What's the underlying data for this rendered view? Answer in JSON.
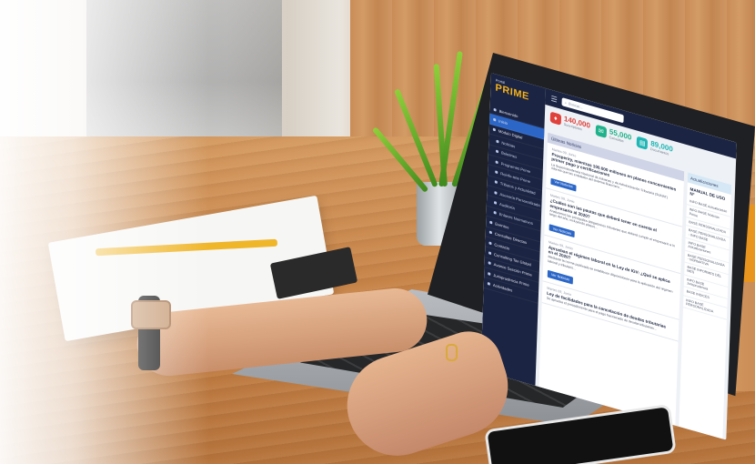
{
  "app": {
    "brand": "PRIME",
    "brand_small": "Portal",
    "search_placeholder": "Buscar..."
  },
  "sidebar": {
    "items": [
      {
        "label": "Bienvenido",
        "active": false,
        "sub": false
      },
      {
        "label": "Inicio",
        "active": true,
        "sub": false
      },
      {
        "label": "Módulo Digital",
        "active": false,
        "sub": false
      },
      {
        "label": "Noticias",
        "active": false,
        "sub": true
      },
      {
        "label": "Boletines",
        "active": false,
        "sub": true
      },
      {
        "label": "Programas Prime",
        "active": false,
        "sub": true
      },
      {
        "label": "Reinfo-arte Prime",
        "active": false,
        "sub": true
      },
      {
        "label": "Tributos y Actualidad",
        "active": false,
        "sub": true
      },
      {
        "label": "Asesoría Personalizada",
        "active": false,
        "sub": true
      },
      {
        "label": "Auditoría",
        "active": false,
        "sub": true
      },
      {
        "label": "Enlaces Normativos",
        "active": false,
        "sub": true
      },
      {
        "label": "Eventos",
        "active": false,
        "sub": false
      },
      {
        "label": "Consultas Directas",
        "active": false,
        "sub": false
      },
      {
        "label": "Contacto",
        "active": false,
        "sub": false
      },
      {
        "label": "Consulting Tax Global",
        "active": false,
        "sub": false
      },
      {
        "label": "Avance Sección Prime",
        "active": false,
        "sub": false
      },
      {
        "label": "Jurisprudencia Prime",
        "active": false,
        "sub": false
      },
      {
        "label": "Actividades",
        "active": false,
        "sub": false
      }
    ]
  },
  "stats": [
    {
      "value": "140,000",
      "label": "Suscriptores",
      "color": "#e0413b",
      "icon": "users-icon",
      "glyph": "♦"
    },
    {
      "value": "55,000",
      "label": "Consultas",
      "color": "#20b28a",
      "icon": "chat-icon",
      "glyph": "✉"
    },
    {
      "value": "89,000",
      "label": "Documentos",
      "color": "#1fb6b5",
      "icon": "doc-icon",
      "glyph": "▤"
    }
  ],
  "news": {
    "header": "Últimas Noticias",
    "items": [
      {
        "date": "Martes 09, Junio",
        "title": "Prosperity, mientras 100.000 millones en planes concernientes primer pago y certificaciones",
        "body": "La Superintendencia Nacional de Aduanas y de Administración Tributaria (SUNAT) informó que las entidades del sistema financiero...",
        "button": "Ver Noticias"
      },
      {
        "date": "Martes 09, Junio",
        "title": "¿Cuáles son las pautas que deberá tener en cuenta el empresario al 2020?",
        "body": "Analizamos las principales obligaciones tributarias que deberá cumplir el empresario a lo largo del año, incluyendo plazos...",
        "button": "Ver Noticias"
      },
      {
        "date": "Martes 09, Junio",
        "title": "Aprueban el régimen laboral en la Ley de IGV: ¿Qué se aplica en el 2020?",
        "body": "Mediante la norma publicada se establecen disposiciones para la aplicación del régimen laboral y tributario...",
        "button": "Ver Noticias"
      },
      {
        "date": "Martes 09, Junio",
        "title": "Ley de facilidades para la cancelación de deudas tributarias",
        "body": "Se aprueba el procedimiento para el pago fraccionado de deudas tributarias...",
        "button": ""
      }
    ]
  },
  "side": {
    "header": "Actualizaciones",
    "title": "MANUAL DE USO N°",
    "rows": [
      "INFO BASE Actualización",
      "INFO BASE Noticias Prime",
      "BASE PERSONALIZADA",
      "BASE PERSONALIZADA - INFO BASE",
      "INFO BASE Actualizaciones",
      "BASE PERSONALIZADA - NORMATIVA",
      "BASE INFORMES DEL MES",
      "INFO BASE Jurisprudencia",
      "BASE INDICES",
      "INFO BASE PERSONALIZADA"
    ]
  }
}
